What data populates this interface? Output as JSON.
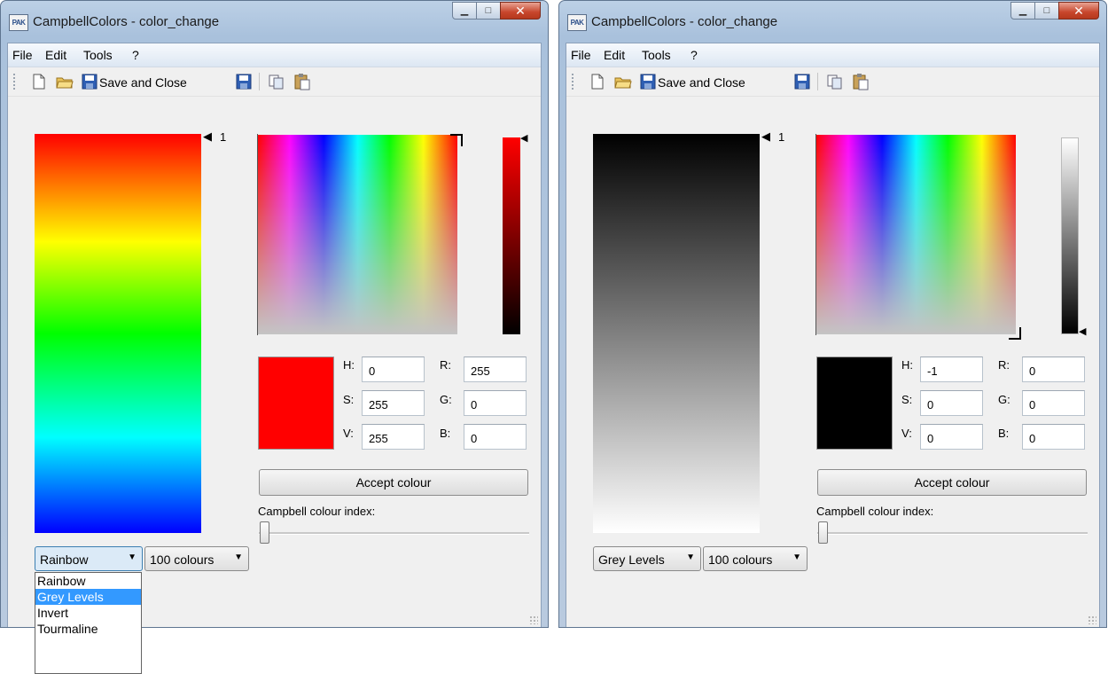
{
  "windows": [
    {
      "title": "CampbellColors - color_change",
      "app_icon_text": "PAK",
      "menu": {
        "file": "File",
        "edit": "Edit",
        "tools": "Tools",
        "help": "?"
      },
      "toolbar": {
        "save_close_label": "Save and Close"
      },
      "colour_index_label": "1",
      "hsv": {
        "h": "0",
        "s": "255",
        "v": "255"
      },
      "rgb": {
        "r": "255",
        "g": "0",
        "b": "0"
      },
      "labels": {
        "h": "H:",
        "s": "S:",
        "v": "V:",
        "r": "R:",
        "g": "G:",
        "b": "B:"
      },
      "swatch_color": "#ff0000",
      "accept_label": "Accept colour",
      "campbell_index_label": "Campbell colour index:",
      "slider_value": 0,
      "palette_combo": "Rainbow",
      "count_combo": "100 colours",
      "palette_options": [
        "Rainbow",
        "Grey Levels",
        "Invert",
        "Tourmaline"
      ]
    },
    {
      "title": "CampbellColors - color_change",
      "app_icon_text": "PAK",
      "menu": {
        "file": "File",
        "edit": "Edit",
        "tools": "Tools",
        "help": "?"
      },
      "toolbar": {
        "save_close_label": "Save and Close"
      },
      "colour_index_label": "1",
      "hsv": {
        "h": "-1",
        "s": "0",
        "v": "0"
      },
      "rgb": {
        "r": "0",
        "g": "0",
        "b": "0"
      },
      "labels": {
        "h": "H:",
        "s": "S:",
        "v": "V:",
        "r": "R:",
        "g": "G:",
        "b": "B:"
      },
      "swatch_color": "#000000",
      "accept_label": "Accept colour",
      "campbell_index_label": "Campbell colour index:",
      "slider_value": 0,
      "palette_combo": "Grey Levels",
      "count_combo": "100 colours"
    }
  ],
  "colors": {
    "titlebar": "#b1c7e0",
    "menu": "#e6eef8",
    "selection": "#3399ff",
    "close_button": "#c7462c"
  }
}
